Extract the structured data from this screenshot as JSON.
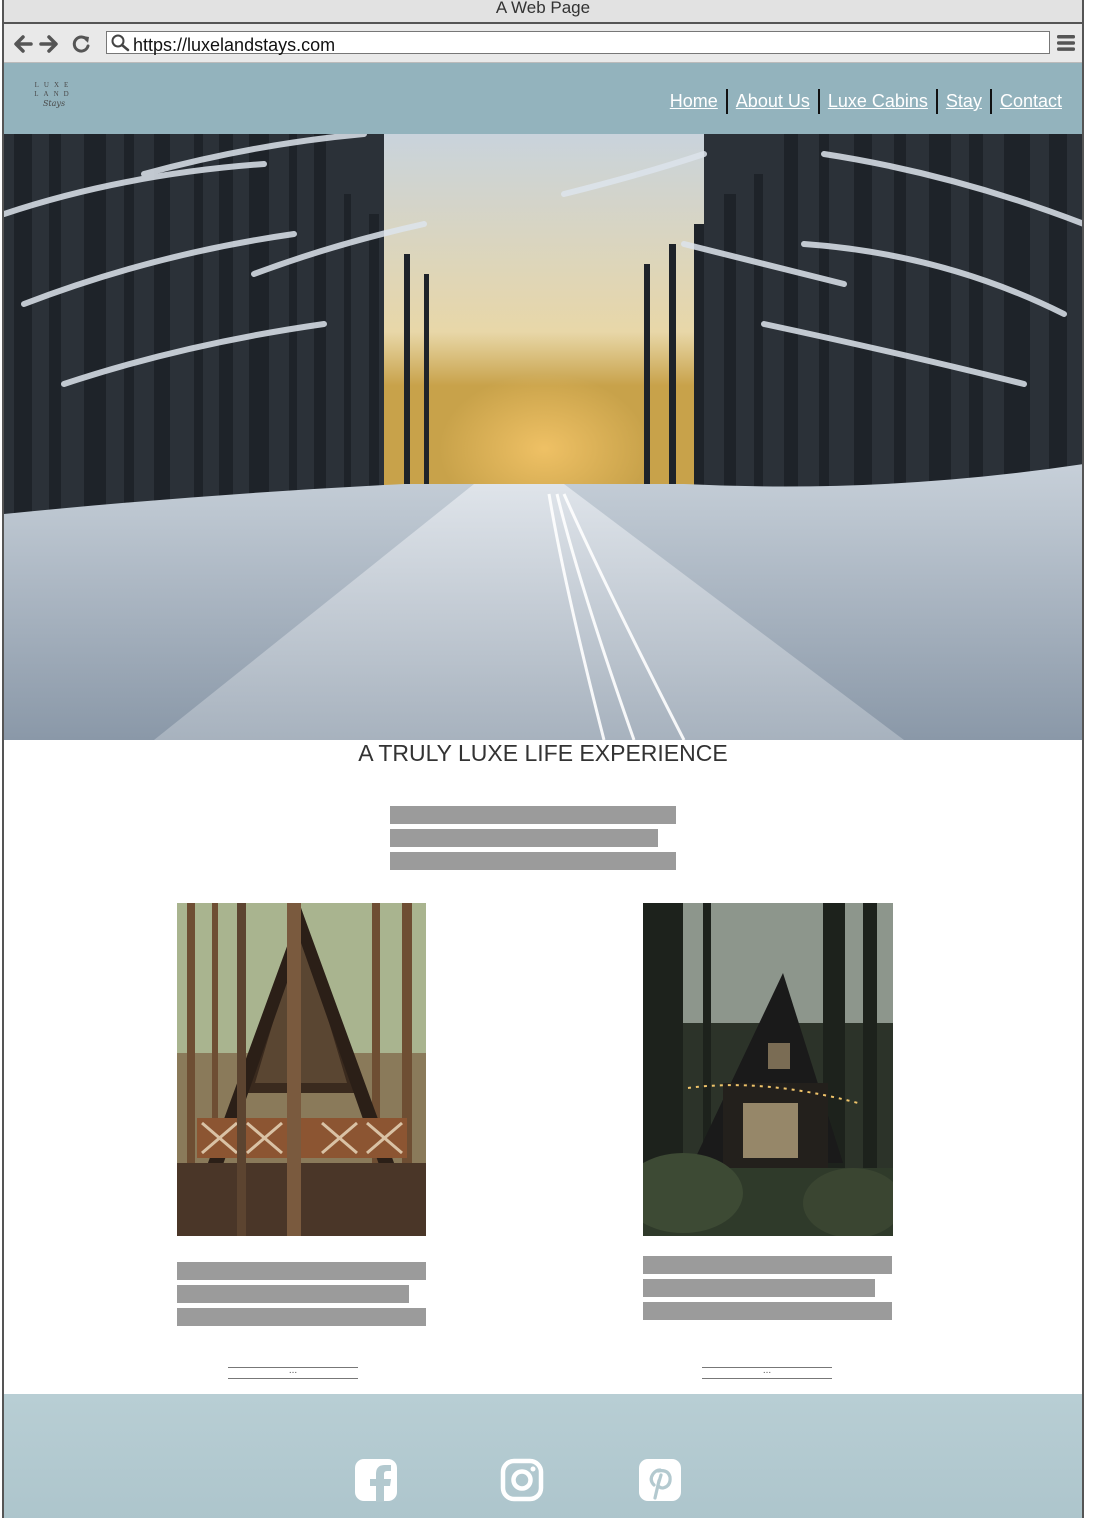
{
  "browser": {
    "window_title": "A Web Page",
    "url": "https://luxelandstays.com"
  },
  "site": {
    "logo": {
      "line1": "LUXE",
      "line2": "LAND",
      "line3": "Stays"
    },
    "nav": [
      "Home",
      "About Us",
      "Luxe Cabins",
      "Stay",
      "Contact"
    ]
  },
  "main": {
    "headline": "A TRULY LUXE LIFE EXPERIENCE",
    "cards": [
      {
        "more_label": "..."
      },
      {
        "more_label": "..."
      }
    ]
  },
  "footer": {
    "social_icons": [
      "facebook-icon",
      "instagram-icon",
      "pinterest-icon"
    ]
  },
  "colors": {
    "header_bg": "#93b3bd",
    "footer_bg": "#b8ced4",
    "placeholder_bar": "#9b9b9b"
  }
}
